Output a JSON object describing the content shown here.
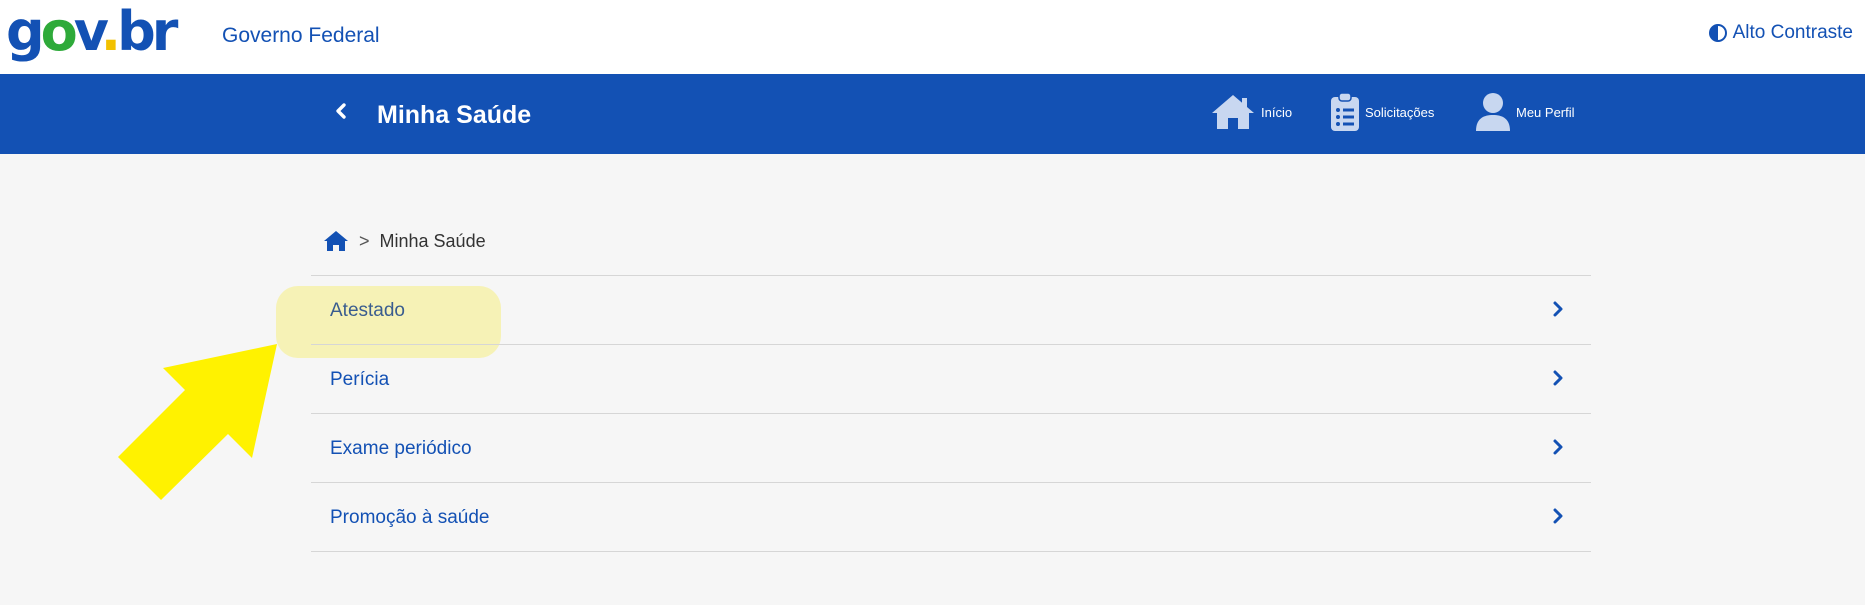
{
  "header": {
    "logo_letters": {
      "g": "g",
      "o": "o",
      "v": "v",
      "dot": ".",
      "br": "br"
    },
    "logo_alt": "gov.br",
    "government": "Governo Federal",
    "contrast": "Alto Contraste"
  },
  "subheader": {
    "title": "Minha Saúde",
    "nav": [
      {
        "label": "Início",
        "icon": "house-icon"
      },
      {
        "label": "Solicitações",
        "icon": "clipboard-list-icon"
      },
      {
        "label": "Meu Perfil",
        "icon": "user-icon"
      }
    ]
  },
  "breadcrumb": {
    "current": "Minha Saúde",
    "separator": ">"
  },
  "menu": [
    {
      "label": "Atestado"
    },
    {
      "label": "Perícia"
    },
    {
      "label": "Exame periódico"
    },
    {
      "label": "Promoção à saúde"
    }
  ],
  "colors": {
    "primary": "#1351b4",
    "page_background": "#f6f6f6",
    "highlight": "#f5f0a0",
    "arrow": "#fff200"
  }
}
